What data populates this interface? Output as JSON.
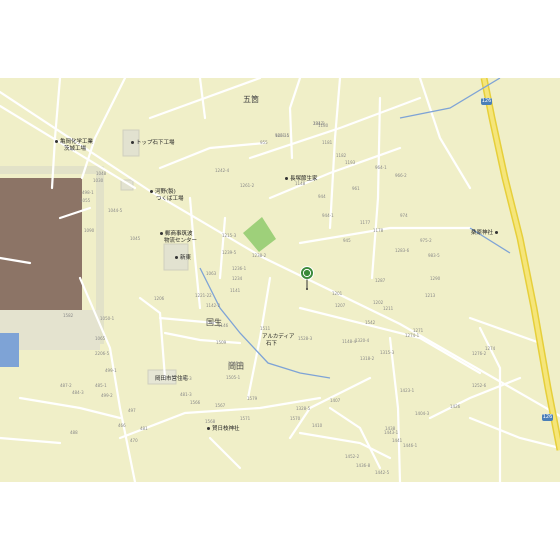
{
  "map": {
    "area_labels": [
      "五箇",
      "国生",
      "岡田"
    ],
    "pois": [
      "亀岡化学工業",
      "茨城工場",
      "トップ石下工場",
      "長塚節生家",
      "河野(製)",
      "つくば工場",
      "郵商事筑波",
      "物流センター",
      "新東",
      "桑原神社",
      "アルカディア",
      "石下",
      "岡田市営住宅",
      "賀日枝神社"
    ],
    "route_shields": [
      "126",
      "126"
    ],
    "lot_numbers": [
      "1312",
      "942-15",
      "1180",
      "1242-4",
      "1261-2",
      "955",
      "1181",
      "1182",
      "1193",
      "1215-3",
      "1239-5",
      "1238-2",
      "1236-1",
      "1234",
      "1221-22",
      "1206",
      "1207",
      "1201",
      "1202",
      "1211",
      "1213",
      "1148-4",
      "1177",
      "1178",
      "1283-6",
      "1287",
      "1290",
      "1271",
      "1274",
      "1276-2",
      "1252-6",
      "1274-1",
      "1320-4",
      "1315-3",
      "1318-2",
      "1328-5",
      "1407",
      "1410",
      "1423-1",
      "1404-3",
      "1426",
      "1438",
      "1441",
      "1452-2",
      "1436-8",
      "1443-1",
      "1446-1",
      "1442-5",
      "1505-3",
      "1505-1",
      "1509",
      "1511",
      "1528-3",
      "1542",
      "1566",
      "1567",
      "1568",
      "1570",
      "1571",
      "1579",
      "1582",
      "2206-5",
      "499-1",
      "499-2",
      "487-2",
      "484-3",
      "486-3",
      "481-3",
      "485-1",
      "481",
      "488",
      "466",
      "470",
      "497",
      "498-1",
      "1030",
      "1044-5",
      "1045",
      "1048",
      "1055",
      "1090",
      "1065",
      "1050-1",
      "1063",
      "1142-2",
      "1141",
      "1146",
      "1148",
      "944",
      "944-1",
      "945",
      "961",
      "964-1",
      "966-2",
      "974",
      "975-2",
      "983-5",
      "284-3",
      "1261-1"
    ]
  }
}
